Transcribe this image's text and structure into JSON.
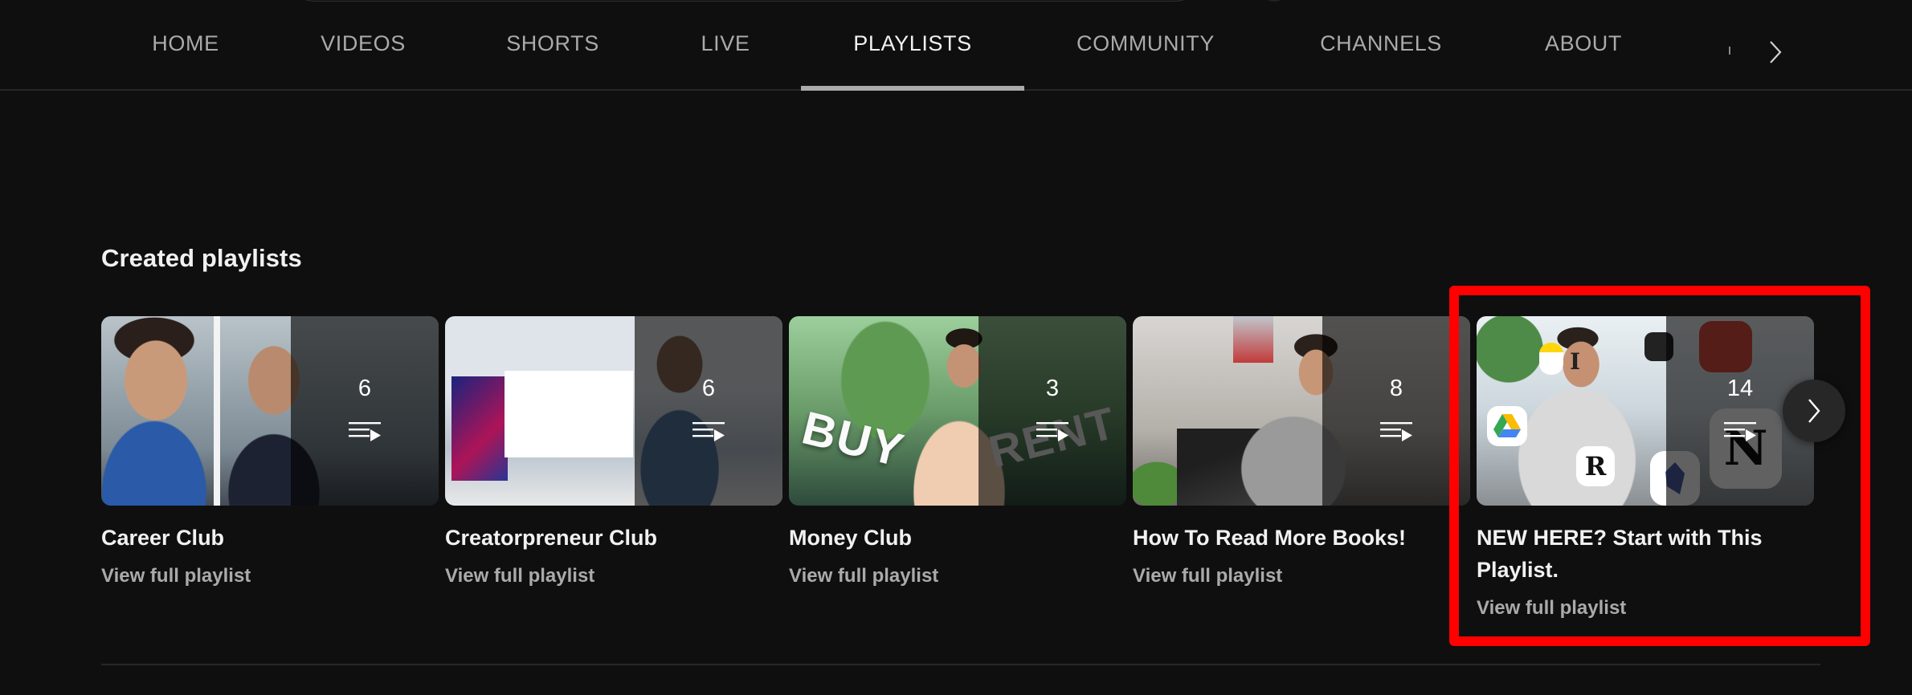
{
  "tabs": {
    "items": [
      {
        "label": "HOME",
        "active": false
      },
      {
        "label": "VIDEOS",
        "active": false
      },
      {
        "label": "SHORTS",
        "active": false
      },
      {
        "label": "LIVE",
        "active": false
      },
      {
        "label": "PLAYLISTS",
        "active": true
      },
      {
        "label": "COMMUNITY",
        "active": false
      },
      {
        "label": "CHANNELS",
        "active": false
      },
      {
        "label": "ABOUT",
        "active": false
      }
    ],
    "next_icon": "chevron-right-icon"
  },
  "section": {
    "title": "Created playlists"
  },
  "playlists": [
    {
      "title": "Career Club",
      "count": "6",
      "link_label": "View full playlist",
      "highlighted": false
    },
    {
      "title": "Creatorpreneur Club",
      "count": "6",
      "link_label": "View full playlist",
      "highlighted": false
    },
    {
      "title": "Money Club",
      "count": "3",
      "link_label": "View full playlist",
      "highlighted": false,
      "thumb_text_left": "BUY",
      "thumb_text_right": "RENT"
    },
    {
      "title": "How To Read More Books!",
      "count": "8",
      "link_label": "View full playlist",
      "highlighted": false
    },
    {
      "title": "NEW HERE? Start with This Playlist.",
      "count": "14",
      "link_label": "View full playlist",
      "highlighted": true
    }
  ],
  "carousel": {
    "next_icon": "chevron-right-icon"
  },
  "colors": {
    "background": "#0f0f0f",
    "text_primary": "#f1f1f1",
    "text_secondary": "#aaaaaa",
    "highlight": "#ff0000",
    "divider": "#272727"
  }
}
